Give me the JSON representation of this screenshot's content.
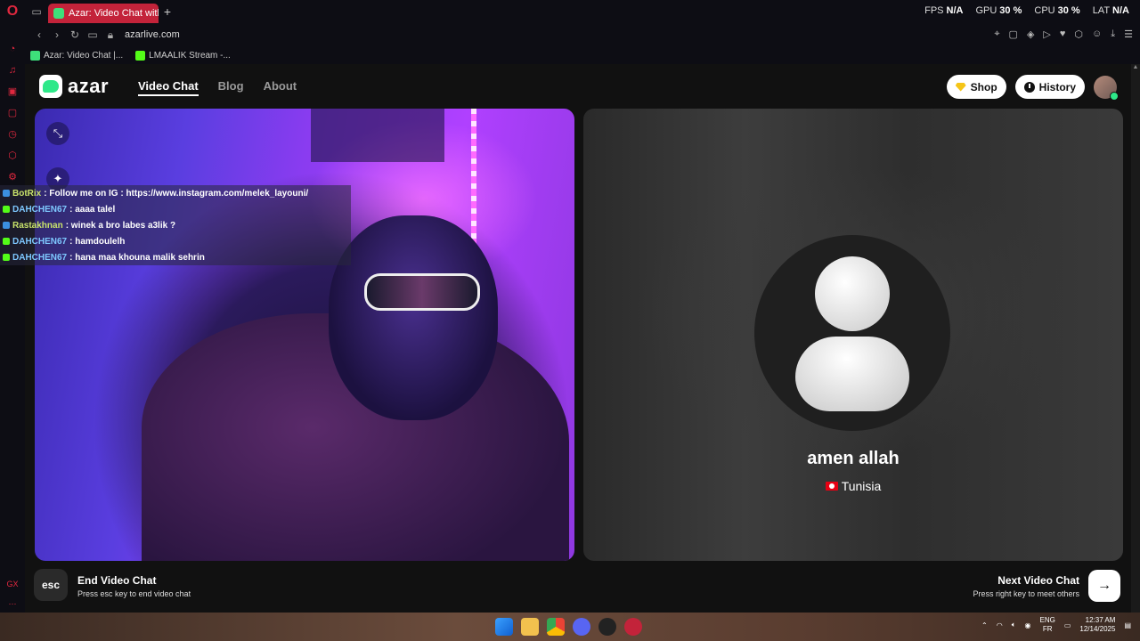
{
  "browser": {
    "tab_title": "Azar: Video Chat with Nev",
    "url": "azarlive.com",
    "stats": [
      {
        "label": "FPS",
        "value": "N/A"
      },
      {
        "label": "GPU",
        "value": "30 %"
      },
      {
        "label": "CPU",
        "value": "30 %"
      },
      {
        "label": "LAT",
        "value": "N/A"
      }
    ],
    "bookmarks": [
      "Azar: Video Chat |...",
      "LMAALIK Stream -..."
    ],
    "sidebar_label": "GX"
  },
  "header": {
    "logo": "azar",
    "nav": [
      "Video Chat",
      "Blog",
      "About"
    ],
    "shop": "Shop",
    "history": "History"
  },
  "chat": [
    {
      "user": "BotRix",
      "msg": ": Follow me on IG : https://www.instagram.com/melek_layouni/",
      "style": "b"
    },
    {
      "user": "DAHCHEN67",
      "msg": ": aaaa talel",
      "style": ""
    },
    {
      "user": "Rastakhnan",
      "msg": ": winek a bro labes a3lik ?",
      "style": "b"
    },
    {
      "user": "DAHCHEN67",
      "msg": ": hamdoulelh",
      "style": ""
    },
    {
      "user": "DAHCHEN67",
      "msg": ": hana maa khouna malik sehrin",
      "style": ""
    }
  ],
  "partner": {
    "name": "amen allah",
    "country": "Tunisia"
  },
  "controls": {
    "esc_key": "esc",
    "end_title": "End Video Chat",
    "end_sub": "Press esc key to end video chat",
    "next_title": "Next Video Chat",
    "next_sub": "Press right key to meet others"
  },
  "taskbar": {
    "lang_top": "ENG",
    "lang_bottom": "FR",
    "time": "12:37 AM",
    "date": "12/14/2025"
  }
}
